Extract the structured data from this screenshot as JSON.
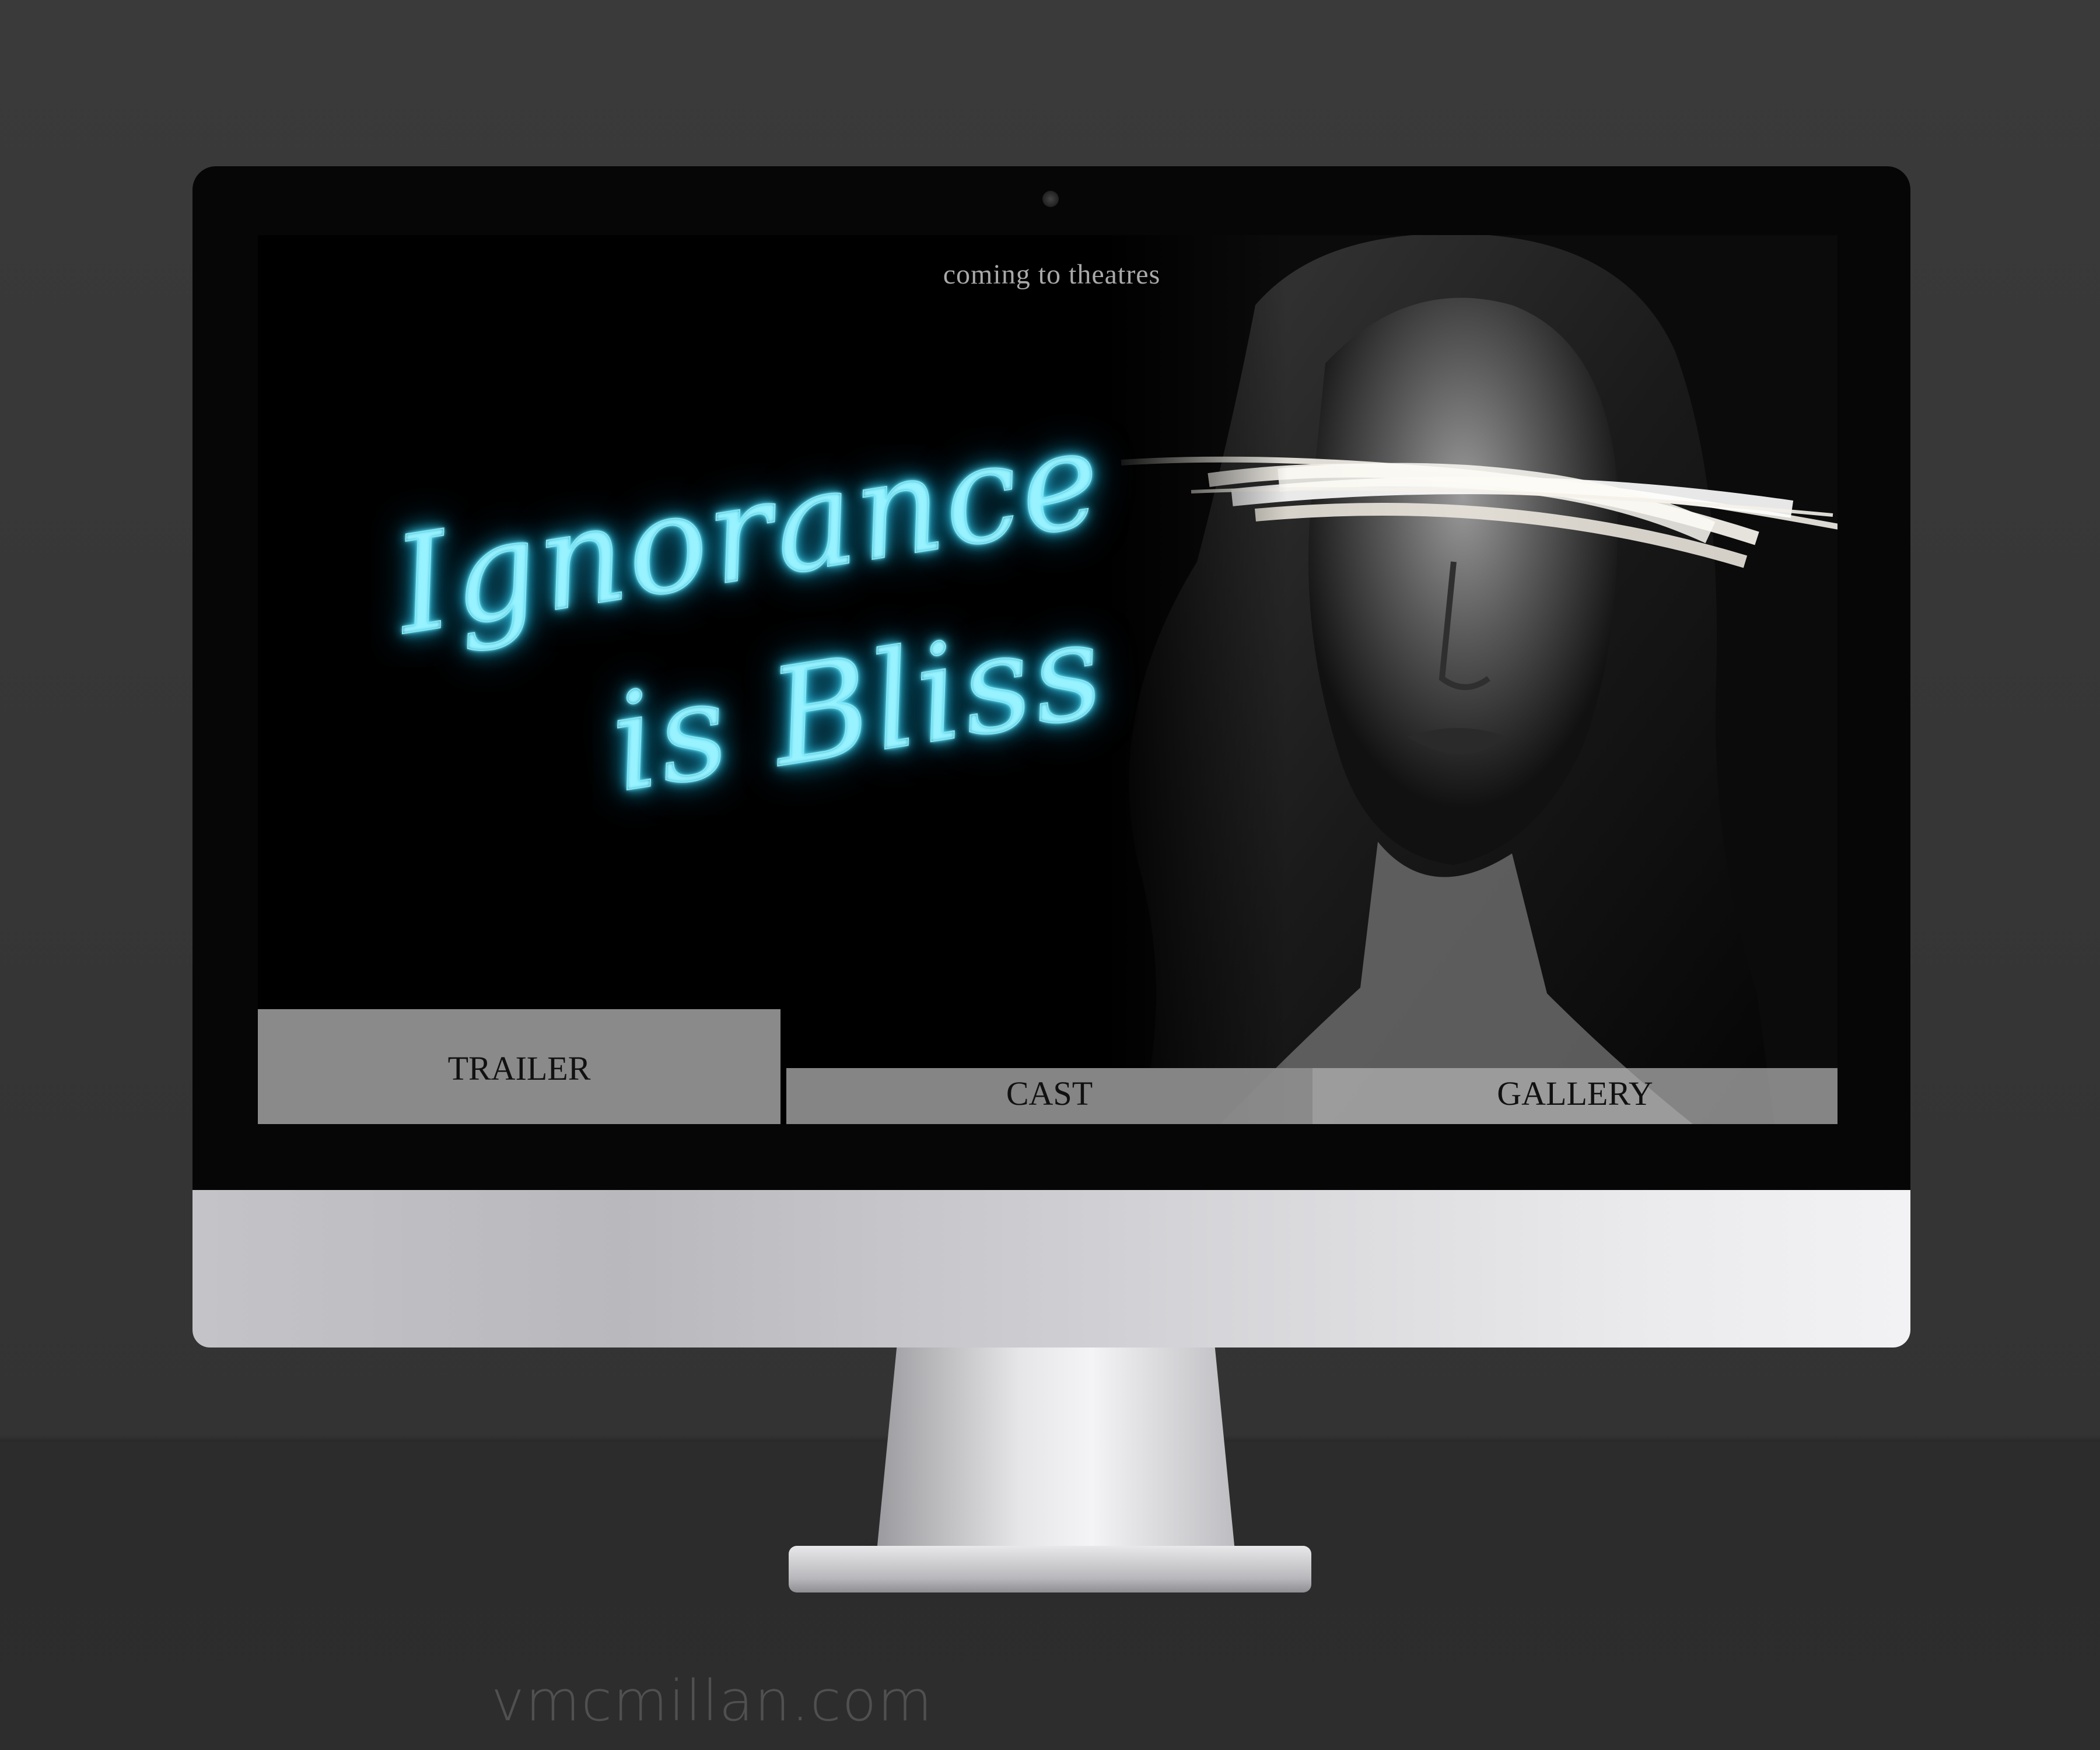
{
  "screen": {
    "tagline": "coming to theatres",
    "title_line1": "Ignorance",
    "title_line2": "is Bliss",
    "nav": {
      "trailer_label": "TRAILER",
      "cast_label": "CAST",
      "gallery_label": "GALLERY"
    }
  },
  "watermark": "vmcmillan.com",
  "colors": {
    "neon": "#7ee9fb",
    "button_gray": "#8a8a8a",
    "background": "#333333"
  }
}
